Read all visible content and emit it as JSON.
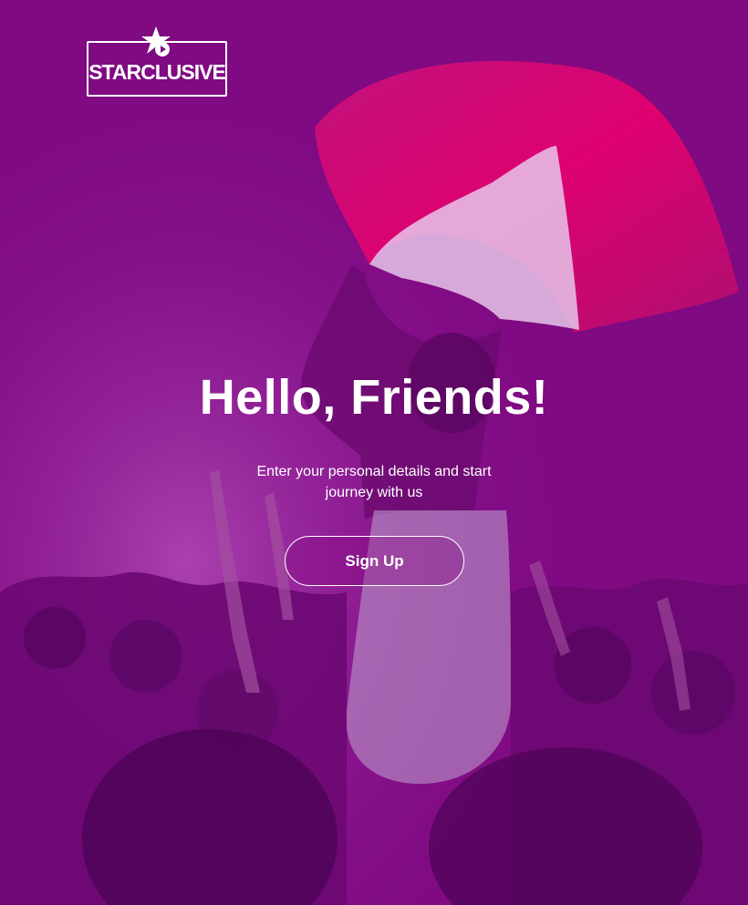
{
  "brand": {
    "logo_text": "STARCLUSIVE",
    "logo_icon": "star-play-icon"
  },
  "hero": {
    "title": "Hello, Friends!",
    "subtitle": "Enter your personal details and start journey with us"
  },
  "actions": {
    "signup_label": "Sign Up"
  },
  "colors": {
    "overlay": "#7f0a82",
    "flag_accent": "#e3006f",
    "text": "#ffffff"
  }
}
